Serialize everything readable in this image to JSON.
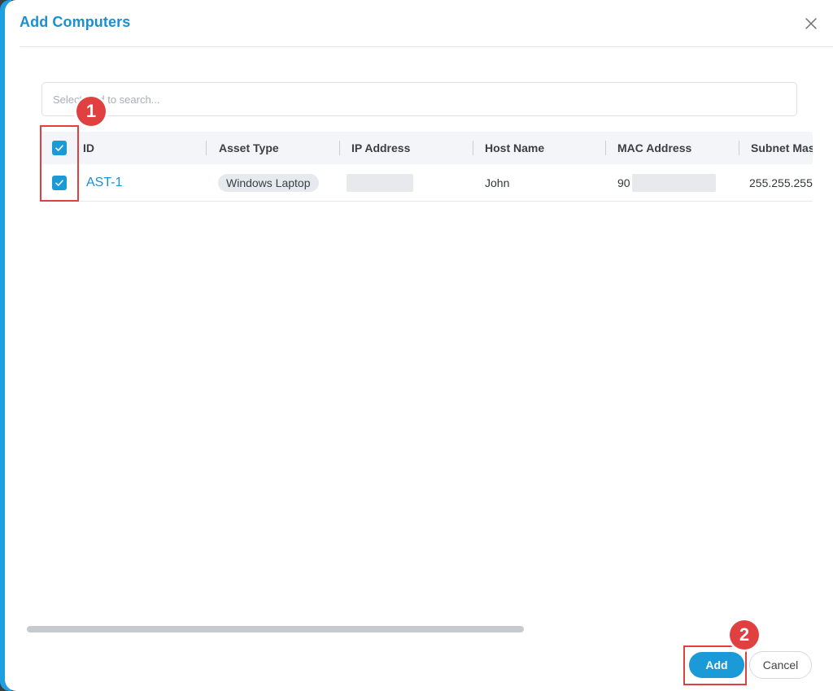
{
  "dialog": {
    "title": "Add Computers",
    "close_icon": "close-icon",
    "accent_color": "#1b8fd1"
  },
  "search": {
    "placeholder": "Select field to search..."
  },
  "table": {
    "columns": [
      "ID",
      "Asset Type",
      "IP Address",
      "Host Name",
      "MAC Address",
      "Subnet Mas"
    ],
    "rows": [
      {
        "id": "AST-1",
        "asset_type": "Windows Laptop",
        "ip_address": "",
        "host_name": "John",
        "mac_address": "90",
        "subnet_mask": "255.255.255",
        "checked": true
      }
    ],
    "header_checked": true
  },
  "footer": {
    "add_label": "Add",
    "cancel_label": "Cancel"
  },
  "annotations": {
    "badge_1": "1",
    "badge_2": "2",
    "color": "#e0403f"
  }
}
